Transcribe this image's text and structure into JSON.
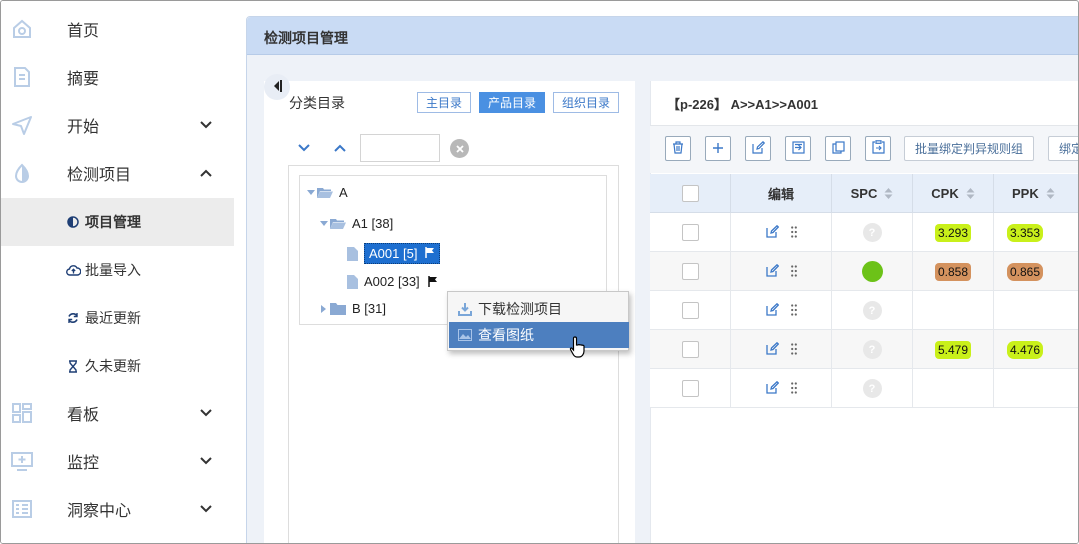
{
  "sidebar": {
    "items": [
      {
        "label": "首页",
        "icon": "home-icon"
      },
      {
        "label": "摘要",
        "icon": "summary-icon"
      },
      {
        "label": "开始",
        "icon": "send-icon"
      },
      {
        "label": "检测项目",
        "icon": "contrast-icon"
      },
      {
        "label": "看板",
        "icon": "dashboard-icon"
      },
      {
        "label": "监控",
        "icon": "monitor-icon"
      },
      {
        "label": "洞察中心",
        "icon": "insight-icon"
      }
    ],
    "sub_items": [
      {
        "label": "项目管理",
        "icon": "contrast-icon"
      },
      {
        "label": "批量导入",
        "icon": "cloud-upload-icon"
      },
      {
        "label": "最近更新",
        "icon": "refresh-icon"
      },
      {
        "label": "久未更新",
        "icon": "hourglass-icon"
      }
    ]
  },
  "main": {
    "title": "检测项目管理"
  },
  "tree": {
    "title": "分类目录",
    "tabs": [
      "主目录",
      "产品目录",
      "组织目录"
    ],
    "active_tab": "产品目录",
    "search_value": "",
    "nodes": {
      "a": "A",
      "a1": "A1 [38]",
      "a001": "A001 [5]",
      "a002": "A002 [33]",
      "b": "B [31]"
    }
  },
  "context_menu": {
    "items": [
      "下载检测项目",
      "查看图纸"
    ],
    "highlighted": "查看图纸"
  },
  "right": {
    "breadcrumb": "【p-226】 A>>A1>>A001",
    "toolbar_text_buttons": [
      "批量绑定判异规则组",
      "绑定"
    ],
    "columns": [
      "编辑",
      "SPC",
      "CPK",
      "PPK"
    ],
    "rows": [
      {
        "spc": "?",
        "cpk": "3.293",
        "ppk": "3.353"
      },
      {
        "spc": "dot",
        "cpk": "0.858",
        "ppk": "0.865"
      },
      {
        "spc": "?",
        "cpk": "",
        "ppk": ""
      },
      {
        "spc": "?",
        "cpk": "5.479",
        "ppk": "4.476"
      },
      {
        "spc": "?",
        "cpk": "",
        "ppk": ""
      }
    ]
  },
  "colors": {
    "accent": "#4a90e2",
    "value_good": "#c9f01a",
    "value_bad": "#d4925e",
    "status_green": "#6cc218"
  }
}
